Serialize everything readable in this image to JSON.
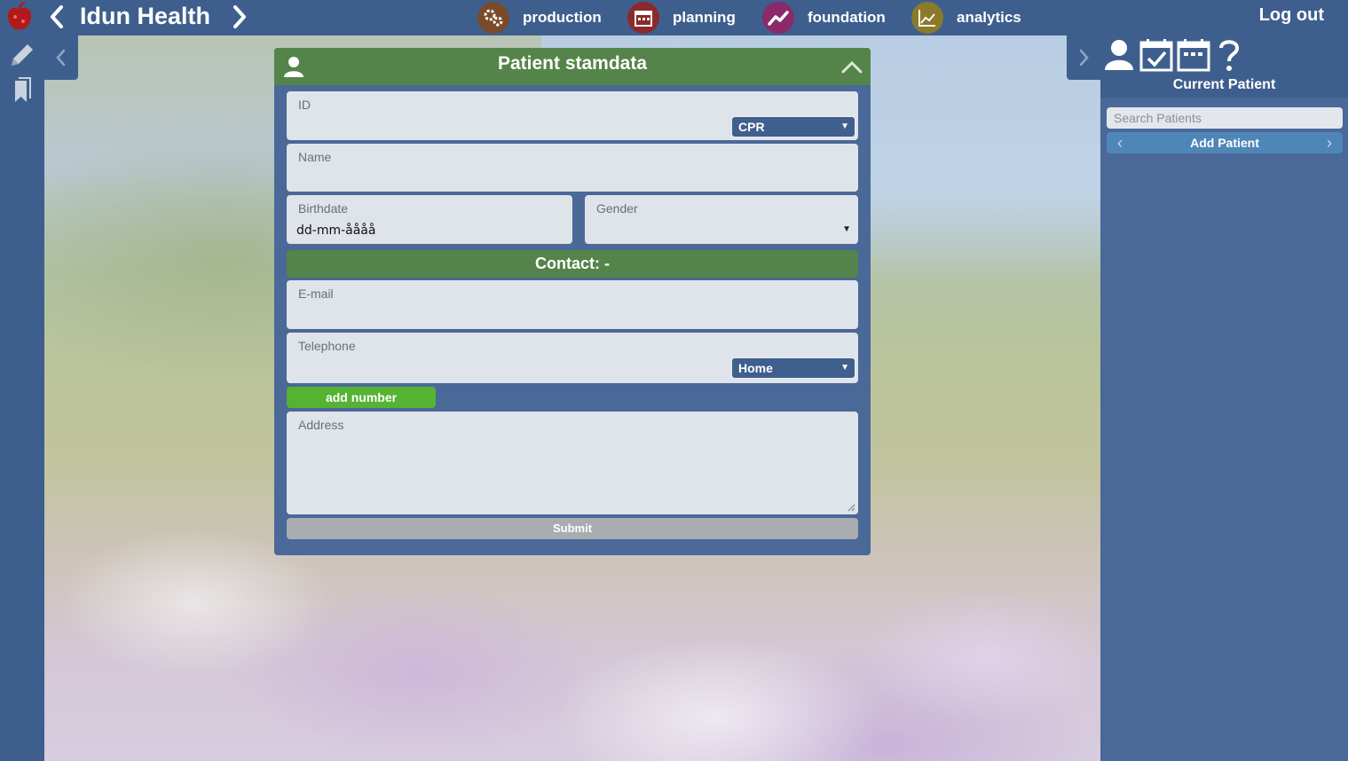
{
  "app": {
    "title": "Idun Health",
    "logout_label": "Log out"
  },
  "nav": [
    {
      "label": "production",
      "icon": "gears-icon",
      "color": "#7a4a2a"
    },
    {
      "label": "planning",
      "icon": "calendar-icon",
      "color": "#8b2a2a"
    },
    {
      "label": "foundation",
      "icon": "trend-line-icon",
      "color": "#8a2a6a"
    },
    {
      "label": "analytics",
      "icon": "area-chart-icon",
      "color": "#8a7a2a"
    }
  ],
  "form": {
    "title": "Patient stamdata",
    "id_label": "ID",
    "id_type_value": "CPR",
    "name_label": "Name",
    "birthdate_label": "Birthdate",
    "birthdate_placeholder": "dd-mm-åååå",
    "gender_label": "Gender",
    "contact_title": "Contact: -",
    "email_label": "E-mail",
    "telephone_label": "Telephone",
    "telephone_type_value": "Home",
    "add_number_label": "add number",
    "address_label": "Address",
    "submit_label": "Submit"
  },
  "right_panel": {
    "title": "Current Patient",
    "search_placeholder": "Search Patients",
    "add_patient_label": "Add Patient",
    "tabs": [
      "person-icon",
      "calendar-check-icon",
      "calendar-icon",
      "help-icon"
    ]
  },
  "colors": {
    "bar": "#3e5f8e",
    "panel": "#4a6898",
    "header_green": "#548449",
    "add_green": "#55b233"
  }
}
